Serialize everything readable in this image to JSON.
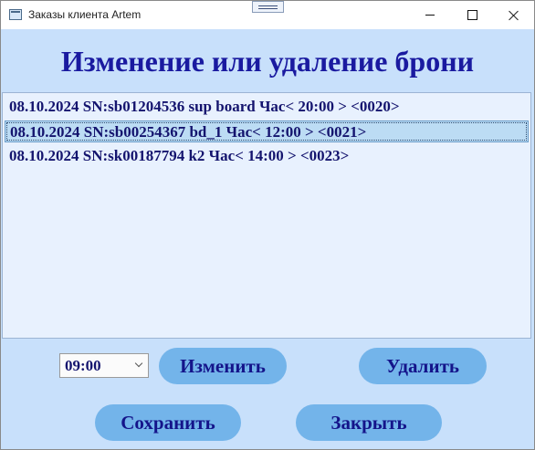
{
  "window": {
    "title": "Заказы клиента Artem"
  },
  "heading": "Изменение или удаление брони",
  "bookings": {
    "items": [
      "08.10.2024 SN:sb01204536 sup board Час< 20:00 > <0020>",
      "08.10.2024 SN:sb00254367 bd_1 Час< 12:00 > <0021>",
      "08.10.2024 SN:sk00187794 k2 Час< 14:00 > <0023>"
    ],
    "selected_index": 1
  },
  "controls": {
    "time_value": "09:00",
    "edit_label": "Изменить",
    "delete_label": "Удалить",
    "save_label": "Сохранить",
    "close_label": "Закрыть"
  },
  "icons": {
    "app": "window-app-icon",
    "drag": "drag-handle-icon",
    "minimize": "minimize-icon",
    "maximize": "maximize-icon",
    "close": "close-icon",
    "dropdown": "chevron-down-icon"
  },
  "colors": {
    "window_background": "#c8e0fb",
    "heading_text": "#1a1aa0",
    "list_background": "#e8f1fe",
    "selection": "#bcdcf4",
    "button": "#73b4ea",
    "button_text": "#14148a"
  }
}
